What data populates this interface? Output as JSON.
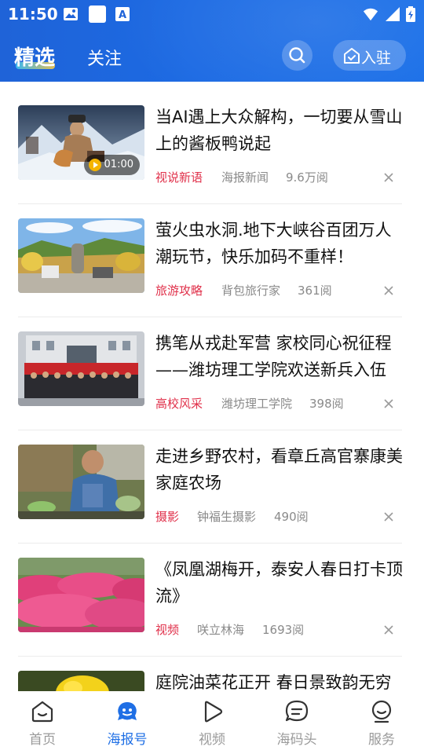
{
  "status_bar": {
    "time": "11:50"
  },
  "header": {
    "tabs": [
      {
        "label": "精选",
        "active": true
      },
      {
        "label": "关注",
        "active": false
      }
    ],
    "search_icon": "search-icon",
    "join_button": {
      "label": "入驻",
      "icon": "join-icon"
    }
  },
  "feed": {
    "items": [
      {
        "title": "当AI遇上大众解构，一切要从雪山上的酱板鸭说起",
        "category": "视说新语",
        "source": "海报新闻",
        "reads": "9.6万阅",
        "video_duration": "01:00"
      },
      {
        "title": "萤火虫水洞.地下大峡谷百团万人潮玩节，快乐加码不重样！",
        "category": "旅游攻略",
        "source": "背包旅行家",
        "reads": "361阅"
      },
      {
        "title": "携笔从戎赴军营 家校同心祝征程——潍坊理工学院欢送新兵入伍",
        "category": "高校风采",
        "source": "潍坊理工学院",
        "reads": "398阅"
      },
      {
        "title": "走进乡野农村，看章丘高官寨康美家庭农场",
        "category": "摄影",
        "source": "钟福生摄影",
        "reads": "490阅"
      },
      {
        "title": "《凤凰湖梅开，泰安人春日打卡顶流》",
        "category": "视频",
        "source": "咲立林海",
        "reads": "1693阅"
      },
      {
        "title": "庭院油菜花正开 春日景致韵无穷"
      }
    ]
  },
  "bottom_nav": {
    "items": [
      {
        "label": "首页",
        "icon": "home-icon"
      },
      {
        "label": "海报号",
        "icon": "haibao-icon",
        "active": true
      },
      {
        "label": "视频",
        "icon": "video-icon"
      },
      {
        "label": "海码头",
        "icon": "chat-icon"
      },
      {
        "label": "服务",
        "icon": "service-icon"
      }
    ]
  },
  "colors": {
    "header_blue": "#1c6ae3",
    "category_red": "#e0304a",
    "active_blue": "#1f6fe5"
  }
}
